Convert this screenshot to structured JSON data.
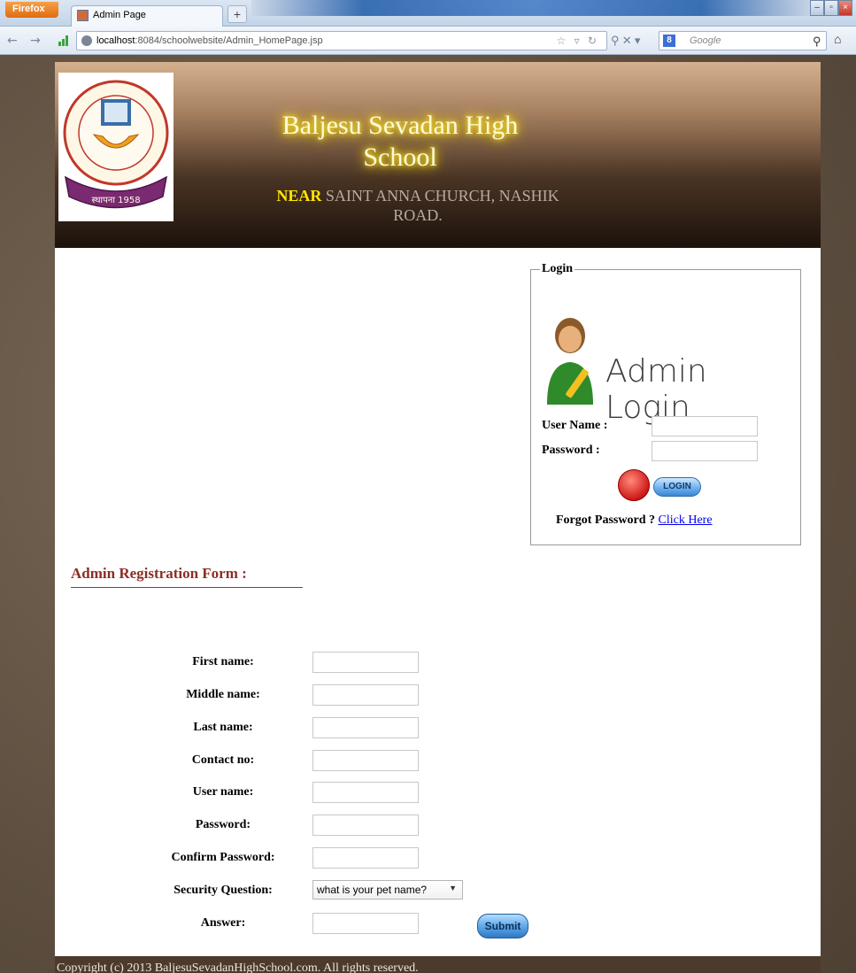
{
  "browser": {
    "menu_button": "Firefox",
    "tab_title": "Admin Page",
    "new_tab": "+",
    "url_host": "localhost",
    "url_rest": ":8084/schoolwebsite/Admin_HomePage.jsp",
    "search_placeholder": "Google",
    "search_engine_letter": "8"
  },
  "header": {
    "school_name": "Baljesu Sevadan High School",
    "address_prefix": "NEAR",
    "address_rest": "SAINT ANNA CHURCH, NASHIK ROAD.",
    "logo_year": "स्थापना 1958"
  },
  "login": {
    "legend": "Login",
    "title": "Admin Login",
    "username_label": "User Name :",
    "password_label": "Password :",
    "button_label": "LOGIN",
    "forgot_text": "Forgot Password ?",
    "forgot_link": "Click Here"
  },
  "registration": {
    "title": "Admin Registration Form :",
    "fields": [
      {
        "label": "First name:"
      },
      {
        "label": "Middle name:"
      },
      {
        "label": "Last name:"
      },
      {
        "label": "Contact no:"
      },
      {
        "label": "User name:"
      },
      {
        "label": "Password:"
      },
      {
        "label": "Confirm Password:"
      }
    ],
    "security_label": "Security Question:",
    "security_selected": "what is your pet name?",
    "answer_label": "Answer:",
    "submit_label": "Submit"
  },
  "footer": {
    "text": "Copyright (c) 2013 BaljesuSevadanHighSchool.com. All rights reserved."
  },
  "colors": {
    "form_title": "#8b2e24",
    "link": "#0000ee",
    "footer_bg": "#4c3a2c",
    "glow": "#ffee33"
  }
}
